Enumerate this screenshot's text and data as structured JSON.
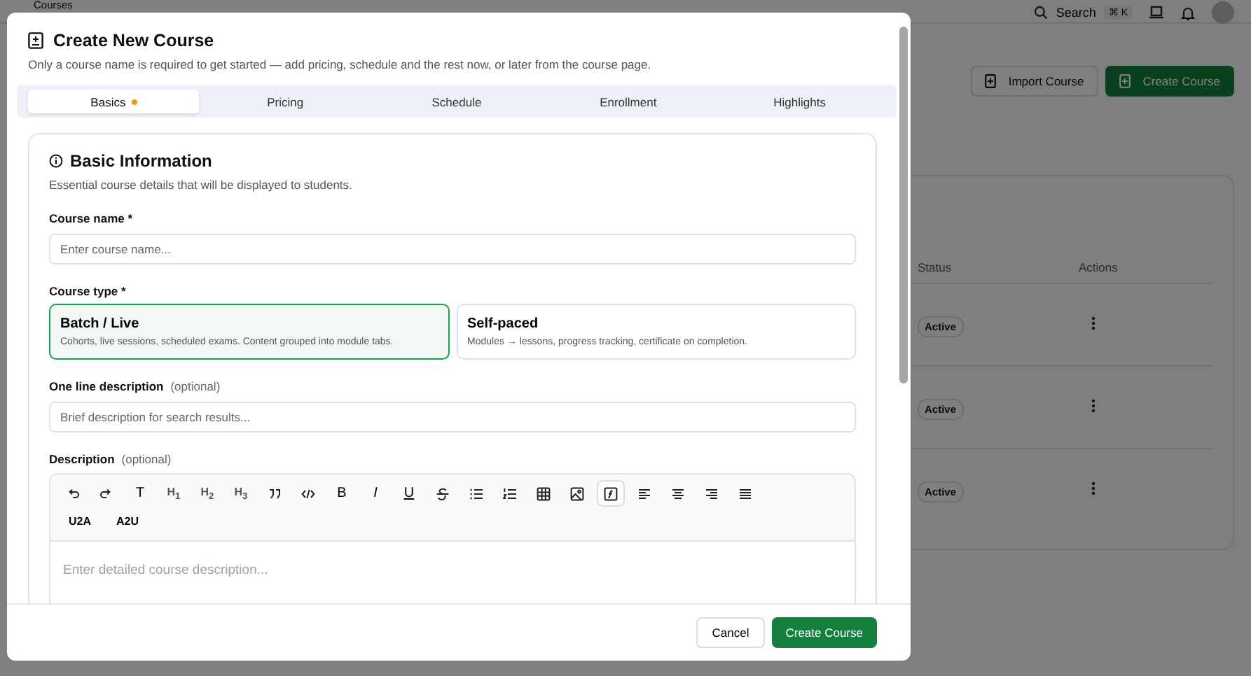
{
  "page": {
    "breadcrumb": "Courses",
    "search": {
      "label": "Search",
      "shortcut": "⌘ K"
    },
    "buttons": [
      {
        "label": "Import Course",
        "kind": "secondary"
      },
      {
        "label": "Create Course",
        "kind": "primary"
      }
    ],
    "table": {
      "columns": [
        "Status",
        "Actions"
      ],
      "rows": [
        {
          "status": "Active"
        },
        {
          "status": "Active"
        },
        {
          "status": "Active"
        }
      ]
    }
  },
  "modal": {
    "title": "Create New Course",
    "subtitle": "Only a course name is required to get started — add pricing, schedule and the rest now, or later from the course page.",
    "tabs": [
      {
        "label": "Basics",
        "selected": true,
        "pending": true
      },
      {
        "label": "Pricing",
        "selected": false,
        "pending": false
      },
      {
        "label": "Schedule",
        "selected": false,
        "pending": false
      },
      {
        "label": "Enrollment",
        "selected": false,
        "pending": false
      },
      {
        "label": "Highlights",
        "selected": false,
        "pending": false
      }
    ],
    "section": {
      "title": "Basic Information",
      "subtitle": "Essential course details that will be displayed to students."
    },
    "course_name": {
      "label": "Course name *",
      "placeholder": "Enter course name..."
    },
    "course_type": {
      "label": "Course type *",
      "options": [
        {
          "title": "Batch / Live",
          "description": "Cohorts, live sessions, scheduled exams. Content grouped into module tabs.",
          "selected": true
        },
        {
          "title": "Self-paced",
          "description": "Modules → lessons, progress tracking, certificate on completion.",
          "selected": false
        }
      ]
    },
    "one_line": {
      "label": "One line description",
      "hint": "(optional)",
      "placeholder": "Brief description for search results..."
    },
    "description": {
      "label": "Description",
      "hint": "(optional)",
      "placeholder": "Enter detailed course description...",
      "toolbar": [
        [
          {
            "kind": "undo",
            "active": false
          },
          {
            "kind": "redo",
            "active": false
          },
          {
            "kind": "letter",
            "label": "T",
            "active": false
          },
          {
            "kind": "heading",
            "label": "H$_{1}$",
            "active": false
          },
          {
            "kind": "heading",
            "label": "H$_{2}$",
            "active": false
          },
          {
            "kind": "heading",
            "label": "H$_{3}$",
            "active": false
          },
          {
            "kind": "quote",
            "active": false
          },
          {
            "kind": "code",
            "active": false
          },
          {
            "kind": "letter",
            "label": "B",
            "active": false
          },
          {
            "kind": "italic",
            "label": "I",
            "active": false
          },
          {
            "kind": "underline",
            "label": "U",
            "active": false
          },
          {
            "kind": "strike",
            "active": false
          },
          {
            "kind": "bullets",
            "active": false
          },
          {
            "kind": "numbers",
            "active": false
          },
          {
            "kind": "table",
            "active": false
          },
          {
            "kind": "image",
            "active": false
          },
          {
            "kind": "function",
            "active": true
          },
          {
            "kind": "align-left",
            "active": false
          },
          {
            "kind": "align-center",
            "active": false
          },
          {
            "kind": "align-right",
            "active": false
          },
          {
            "kind": "justify",
            "active": false
          }
        ],
        [
          {
            "kind": "word",
            "label": "U2A",
            "active": false
          },
          {
            "kind": "word",
            "label": "A2U",
            "active": false
          }
        ]
      ]
    },
    "footer": {
      "cancel": "Cancel",
      "submit": "Create Course"
    }
  }
}
